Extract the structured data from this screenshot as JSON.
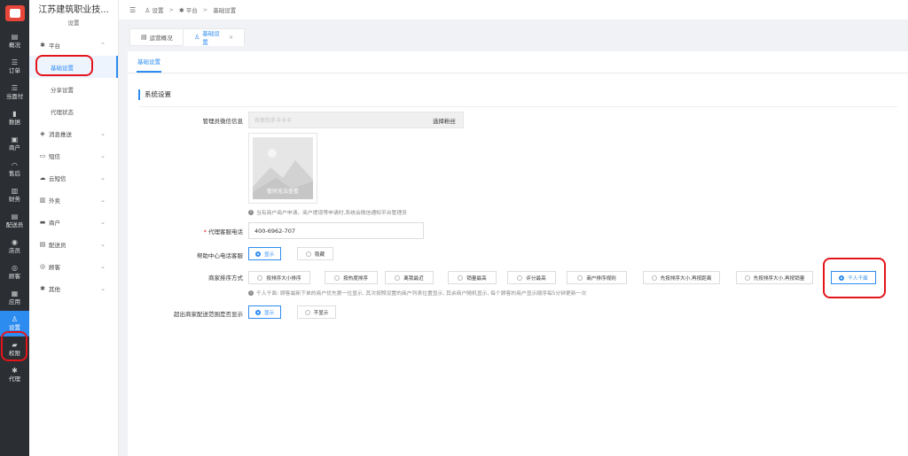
{
  "app": {
    "title": "江苏建筑职业技...",
    "subtitle": "设置"
  },
  "colors": {
    "accent": "#2d8cf0",
    "rail_bg": "#2b2f33",
    "highlight": "#e3141b"
  },
  "rail": {
    "items": [
      {
        "label": "概况",
        "icon": "monitor-icon",
        "glyph": "▤"
      },
      {
        "label": "订单",
        "icon": "list-icon",
        "glyph": "☰"
      },
      {
        "label": "当面付",
        "icon": "list-icon",
        "glyph": "☰"
      },
      {
        "label": "数据",
        "icon": "bar-chart-icon",
        "glyph": "▮"
      },
      {
        "label": "商户",
        "icon": "store-icon",
        "glyph": "▣"
      },
      {
        "label": "售后",
        "icon": "headset-icon",
        "glyph": "◠"
      },
      {
        "label": "财务",
        "icon": "book-icon",
        "glyph": "▥"
      },
      {
        "label": "配送员",
        "icon": "delivery-icon",
        "glyph": "▤"
      },
      {
        "label": "店员",
        "icon": "user-icon",
        "glyph": "◉"
      },
      {
        "label": "顾客",
        "icon": "customer-icon",
        "glyph": "◎"
      },
      {
        "label": "应用",
        "icon": "apps-icon",
        "glyph": "▦"
      },
      {
        "label": "设置",
        "icon": "user-settings-icon",
        "glyph": "♙"
      },
      {
        "label": "权限",
        "icon": "lock-icon",
        "glyph": "▰"
      },
      {
        "label": "代理",
        "icon": "gear-icon",
        "glyph": "✱"
      }
    ]
  },
  "side2": {
    "groups": [
      {
        "label": "平台",
        "icon": "gear-icon",
        "glyph": "✱",
        "chev": "⌃",
        "expanded": true,
        "children": [
          {
            "label": "基础设置"
          },
          {
            "label": "分享设置"
          },
          {
            "label": "代理状态"
          }
        ]
      },
      {
        "label": "消息推送",
        "icon": "broadcast-icon",
        "glyph": "◈",
        "chev": "⌄"
      },
      {
        "label": "短信",
        "icon": "message-icon",
        "glyph": "▭",
        "chev": "⌄"
      },
      {
        "label": "云短信",
        "icon": "cloud-icon",
        "glyph": "☁",
        "chev": "⌄"
      },
      {
        "label": "外卖",
        "icon": "takeout-icon",
        "glyph": "▥",
        "chev": "⌄"
      },
      {
        "label": "商户",
        "icon": "store-icon",
        "glyph": "▬",
        "chev": "⌄"
      },
      {
        "label": "配送员",
        "icon": "delivery-icon",
        "glyph": "▤",
        "chev": "⌄"
      },
      {
        "label": "顾客",
        "icon": "customer-icon",
        "glyph": "◎",
        "chev": "⌄"
      },
      {
        "label": "其他",
        "icon": "gear-icon",
        "glyph": "✱",
        "chev": "⌄"
      }
    ]
  },
  "topbar": {
    "menu_icon_glyph": "☰",
    "breadcrumb": [
      {
        "label": "设置",
        "icon": "user-settings-icon",
        "glyph": "♙"
      },
      {
        "label": "平台",
        "icon": "gear-icon",
        "glyph": "✱"
      },
      {
        "label": "基础设置",
        "icon": "",
        "glyph": ""
      }
    ],
    "separator": ">"
  },
  "tabs": [
    {
      "label": "运营概况",
      "icon": "dashboard-icon",
      "glyph": "▤"
    },
    {
      "label": "基础设置",
      "icon": "user-settings-icon",
      "glyph": "♙",
      "close": "×"
    }
  ],
  "main": {
    "card_tab": "基础设置",
    "section_title": "系统设置",
    "wechat": {
      "label": "管理员微信信息",
      "placeholder": "有新的手卡卡卡",
      "select_button": "选择粉丝",
      "image_caption": "暂时无法查看",
      "help": "当有商户商户申请，商户提现等申请时,系统会微信通知平台管理员"
    },
    "phone": {
      "label": "代理客服电话",
      "value": "400-6962-707"
    },
    "help_center": {
      "label": "帮助中心电话客服",
      "options": [
        "显示",
        "隐藏"
      ],
      "selected": "显示"
    },
    "sort": {
      "label": "商家排序方式",
      "options": [
        "按排序大小排序",
        "按热度排序",
        "离我最近",
        "销量最高",
        "评分最高",
        "商户排序规则",
        "先按排序大小,再按距离",
        "先按排序大小,再按销量",
        "千人千面"
      ],
      "selected": "千人千面",
      "help": "千人千面: 顾客最新下单的商户优先第一位显示, 其次按照设置的商户列表位置显示, 其余商户随机显示, 每个顾客的商户显示顺序每5分钟更新一次"
    },
    "out_of_range": {
      "label": "超出商家配送范围是否显示",
      "options": [
        "显示",
        "不显示"
      ],
      "selected": "显示"
    }
  }
}
